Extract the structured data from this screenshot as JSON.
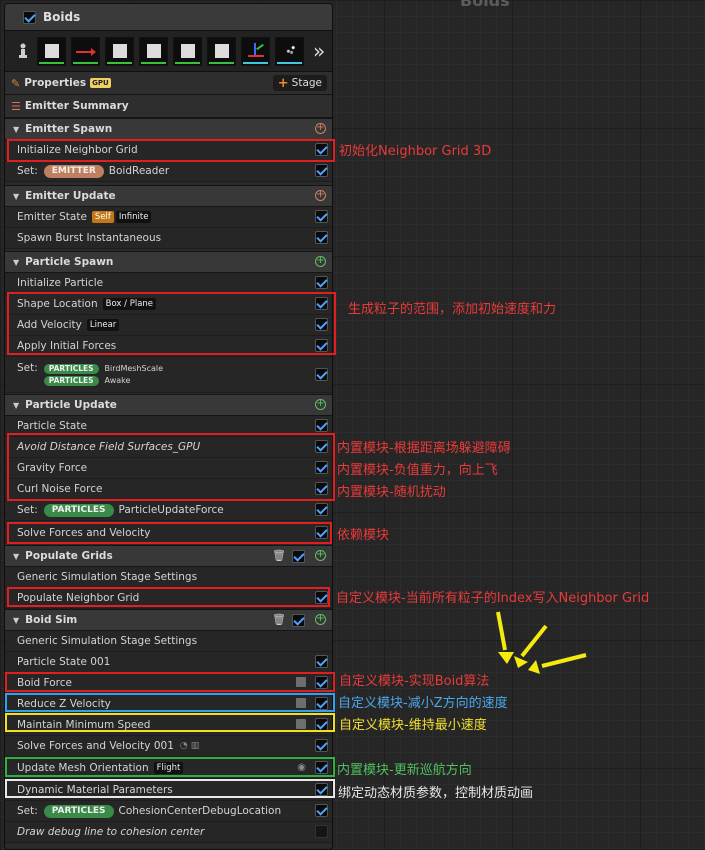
{
  "graph": {
    "title": "Boids"
  },
  "emitter": {
    "title": "Boids"
  },
  "properties": {
    "label": "Properties",
    "gpu_badge": "GPU",
    "stage_button": "Stage"
  },
  "summary": {
    "label": "Emitter Summary"
  },
  "sections": {
    "emitter_spawn": "Emitter Spawn",
    "emitter_update": "Emitter Update",
    "particle_spawn": "Particle Spawn",
    "particle_update": "Particle Update",
    "populate_grids": "Populate Grids",
    "boid_sim": "Boid Sim"
  },
  "rows": {
    "init_grid": "Initialize Neighbor Grid",
    "set_label": "Set:",
    "emitter_pill": "EMITTER",
    "boid_reader": "BoidReader",
    "emitter_state": "Emitter State",
    "emitter_state_self": "Self",
    "emitter_state_infinite": "Infinite",
    "spawn_burst": "Spawn Burst Instantaneous",
    "init_particle": "Initialize Particle",
    "shape_location": "Shape Location",
    "shape_location_tag": "Box / Plane",
    "add_velocity": "Add Velocity",
    "add_velocity_tag": "Linear",
    "apply_forces": "Apply Initial Forces",
    "particles_pill": "PARTICLES",
    "bird_mesh_scale": "BirdMeshScale",
    "awake": "Awake",
    "particle_state": "Particle State",
    "avoid_distance": "Avoid Distance Field Surfaces_GPU",
    "gravity": "Gravity Force",
    "curl_noise": "Curl Noise Force",
    "particle_update_force": "ParticleUpdateForce",
    "solve_forces": "Solve Forces and Velocity",
    "generic_sim_1": "Generic Simulation Stage Settings",
    "populate_neighbor_grid": "Populate Neighbor Grid",
    "generic_sim_2": "Generic Simulation Stage Settings",
    "particle_state_001": "Particle State 001",
    "boid_force": "Boid Force",
    "reduce_z": "Reduce Z Velocity",
    "maintain_speed": "Maintain Minimum Speed",
    "solve_forces_001": "Solve Forces and Velocity 001",
    "update_mesh": "Update Mesh Orientation",
    "update_mesh_tag": "Flight",
    "dynamic_material": "Dynamic Material Parameters",
    "cohesion_debug": "CohesionCenterDebugLocation",
    "draw_debug": "Draw debug line to cohesion center"
  },
  "annotations": {
    "init_grid": "初始化Neighbor Grid 3D",
    "spawn_range": "生成粒子的范围，添加初始速度和力",
    "avoid": "内置模块-根据距离场躲避障碍",
    "gravity": "内置模块-负值重力，向上飞",
    "curl": "内置模块-随机扰动",
    "depend": "依赖模块",
    "populate": "自定义模块-当前所有粒子的Index写入Neighbor Grid",
    "boid_force": "自定义模块-实现Boid算法",
    "reduce_z": "自定义模块-减小Z方向的速度",
    "maintain": "自定义模块-维持最小速度",
    "update_mesh": "内置模块-更新巡航方向",
    "dynamic": "绑定动态材质参数，控制材质动画"
  },
  "colors": {
    "red": "#e02020",
    "blue": "#30a0f0",
    "yellow": "#f0e020",
    "green": "#30b040",
    "white": "#e8e8e8",
    "check": "#4ea3ff"
  },
  "icons": [
    "checkbox-icon",
    "person-icon",
    "pencil-icon",
    "gpu-icon",
    "plus-icon",
    "list-icon",
    "trash-icon",
    "eye-icon",
    "edit-icon",
    "more-icon"
  ]
}
